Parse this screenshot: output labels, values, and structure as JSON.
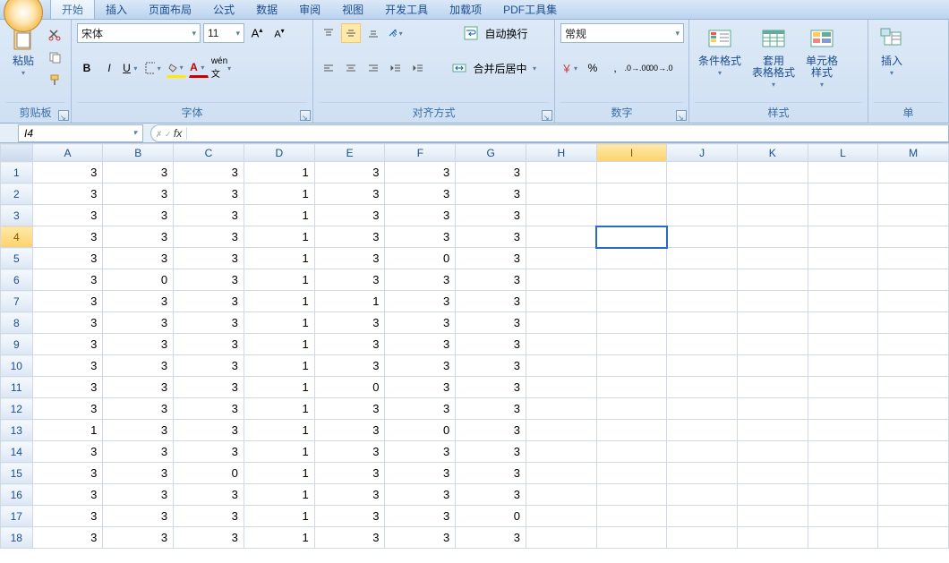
{
  "tabs": [
    "开始",
    "插入",
    "页面布局",
    "公式",
    "数据",
    "审阅",
    "视图",
    "开发工具",
    "加载项",
    "PDF工具集"
  ],
  "active_tab": 0,
  "ribbon": {
    "clipboard": {
      "label": "剪贴板",
      "paste": "粘贴"
    },
    "font": {
      "label": "字体",
      "name": "宋体",
      "size": "11"
    },
    "align": {
      "label": "对齐方式",
      "wrap": "自动换行",
      "merge": "合并后居中"
    },
    "number": {
      "label": "数字",
      "format": "常规"
    },
    "styles": {
      "label": "样式",
      "cond": "条件格式",
      "table": "套用\n表格格式",
      "cell": "单元格\n样式"
    },
    "insert": {
      "label": "单",
      "insert": "插入"
    }
  },
  "namebox": "I4",
  "formula": "",
  "columns": [
    "A",
    "B",
    "C",
    "D",
    "E",
    "F",
    "G",
    "H",
    "I",
    "J",
    "K",
    "L",
    "M"
  ],
  "selected_col": "I",
  "selected_row": 4,
  "data_rows": [
    [
      3,
      3,
      3,
      1,
      3,
      3,
      3
    ],
    [
      3,
      3,
      3,
      1,
      3,
      3,
      3
    ],
    [
      3,
      3,
      3,
      1,
      3,
      3,
      3
    ],
    [
      3,
      3,
      3,
      1,
      3,
      3,
      3
    ],
    [
      3,
      3,
      3,
      1,
      3,
      0,
      3
    ],
    [
      3,
      0,
      3,
      1,
      3,
      3,
      3
    ],
    [
      3,
      3,
      3,
      1,
      1,
      3,
      3
    ],
    [
      3,
      3,
      3,
      1,
      3,
      3,
      3
    ],
    [
      3,
      3,
      3,
      1,
      3,
      3,
      3
    ],
    [
      3,
      3,
      3,
      1,
      3,
      3,
      3
    ],
    [
      3,
      3,
      3,
      1,
      0,
      3,
      3
    ],
    [
      3,
      3,
      3,
      1,
      3,
      3,
      3
    ],
    [
      1,
      3,
      3,
      1,
      3,
      0,
      3
    ],
    [
      3,
      3,
      3,
      1,
      3,
      3,
      3
    ],
    [
      3,
      3,
      0,
      1,
      3,
      3,
      3
    ],
    [
      3,
      3,
      3,
      1,
      3,
      3,
      3
    ],
    [
      3,
      3,
      3,
      1,
      3,
      3,
      0
    ],
    [
      3,
      3,
      3,
      1,
      3,
      3,
      3
    ]
  ]
}
